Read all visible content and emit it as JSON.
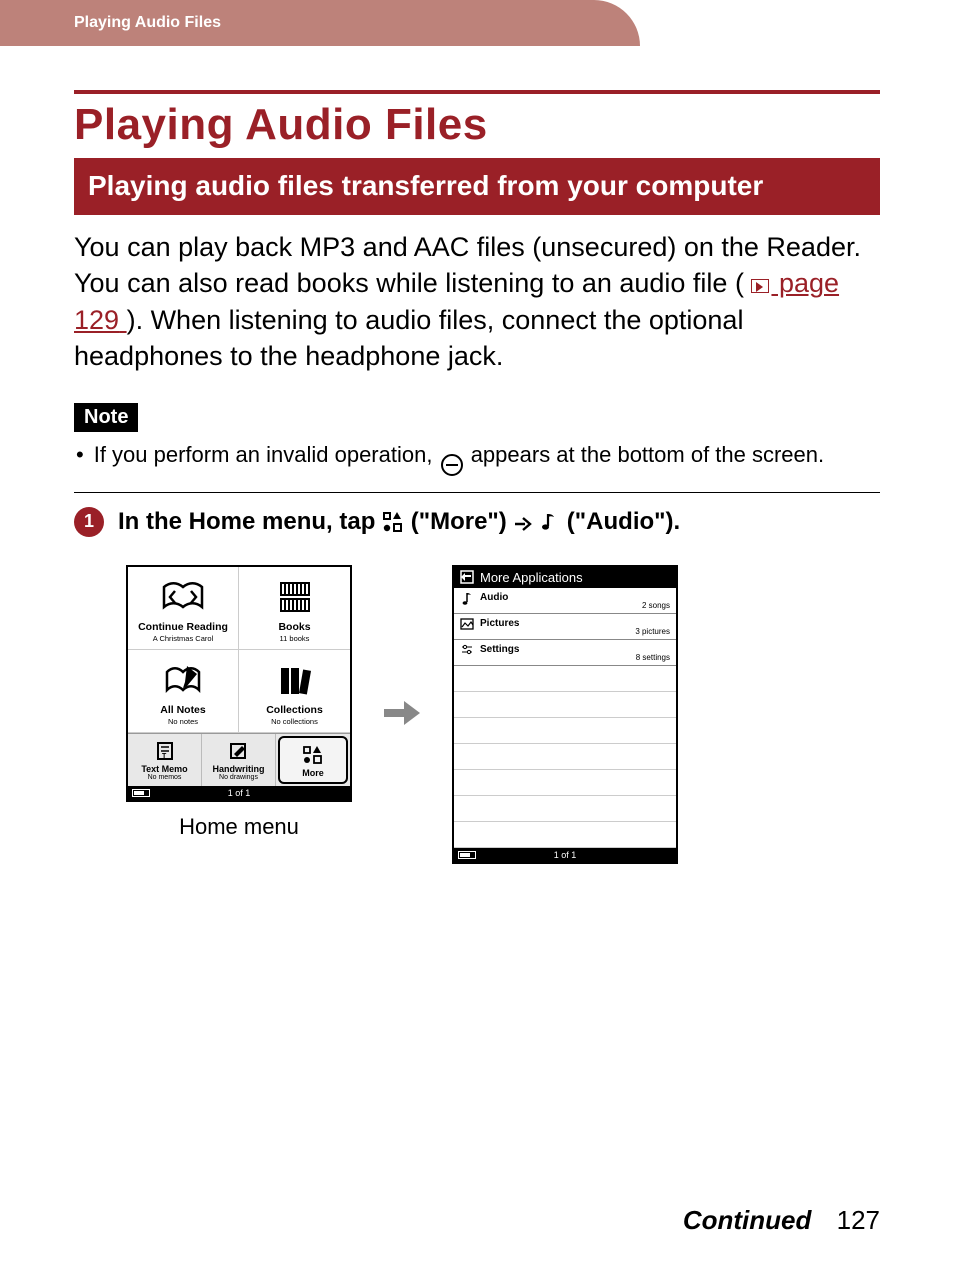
{
  "header": {
    "breadcrumb": "Playing Audio Files"
  },
  "title": "Playing Audio Files",
  "subtitle": "Playing audio files transferred from your computer",
  "body": {
    "p1a": "You can play back MP3 and AAC files (unsecured) on the Reader. You can also read books while listening to an audio file (",
    "page_ref": " page 129",
    "p1b": "). When listening to audio files, connect the optional headphones to the headphone jack."
  },
  "note": {
    "label": "Note",
    "text_a": "If you perform an invalid operation, ",
    "text_b": " appears at the bottom of the screen."
  },
  "step1": {
    "num": "1",
    "a": "In the Home menu, tap ",
    "more": " (\"More\") ",
    "audio": " (\"Audio\")."
  },
  "home_screen": {
    "caption": "Home menu",
    "status_page": "1 of 1",
    "tiles": [
      {
        "label": "Continue Reading",
        "sub": "A Christmas Carol",
        "icon": "book-open-arrows"
      },
      {
        "label": "Books",
        "sub": "11 books",
        "icon": "bookshelf"
      },
      {
        "label": "All Notes",
        "sub": "No notes",
        "icon": "note-pencil"
      },
      {
        "label": "Collections",
        "sub": "No collections",
        "icon": "books-stack"
      }
    ],
    "bottom": [
      {
        "label": "Text Memo",
        "sub": "No memos",
        "icon": "text-memo"
      },
      {
        "label": "Handwriting",
        "sub": "No drawings",
        "icon": "handwriting"
      },
      {
        "label": "More",
        "sub": "",
        "icon": "more-apps"
      }
    ]
  },
  "apps_screen": {
    "title": "More Applications",
    "status_page": "1 of 1",
    "rows": [
      {
        "label": "Audio",
        "sub": "2 songs",
        "icon": "music-note"
      },
      {
        "label": "Pictures",
        "sub": "3 pictures",
        "icon": "picture"
      },
      {
        "label": "Settings",
        "sub": "8 settings",
        "icon": "sliders"
      }
    ]
  },
  "footer": {
    "continued": "Continued",
    "page": "127"
  }
}
